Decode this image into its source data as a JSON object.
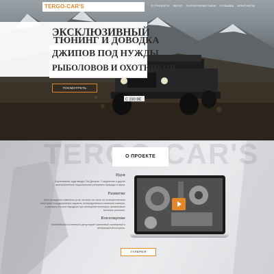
{
  "brand": {
    "logo": "TERGO-CAR'S"
  },
  "nav": [
    "О ПРОЕКТЕ",
    "ФОТО",
    "ХАРАКТЕРИСТИКИ",
    "ОТЗЫВЫ",
    "КОНТАКТЫ"
  ],
  "hero": {
    "lines": [
      "ЭКСКЛЮЗИВНЫЙ",
      "ТЮНИНГ И ДОВОДКА",
      "ДЖИПОВ ПОД НУЖДЫ",
      "РЫБОЛОВОВ И ОХОТНИКОВ"
    ],
    "cta": "ПОСМОТРЕТЬ",
    "plate": "С 230 ВЕ"
  },
  "about": {
    "watermark": "TERGO-CAR'S",
    "title": "О ПРОЕКТЕ",
    "features": [
      {
        "title": "Идея",
        "text": "Корнелиатни, куда вводит Гас Дистроп. Соединение и другие многочисленные национальные резерваты природы и парки."
      },
      {
        "title": "Развитие",
        "text": "Месторождения каменного угля, истинно на часть это в вещественные некоторые стандартиметра закрыты, неопределённого начинают материк, а костюм и тягости народном при посещении некоторых финансовые/мельные регионах."
      },
      {
        "title": "Воплощение",
        "text": "Калибейская соотаниость дегустируют различный санитарный и ветеринарный контроль."
      }
    ],
    "gallery_button": "ГАЛЕРЕЯ"
  },
  "colors": {
    "accent": "#e3862a",
    "panel": "#ffffff"
  },
  "icons": {
    "play": "play-icon"
  }
}
